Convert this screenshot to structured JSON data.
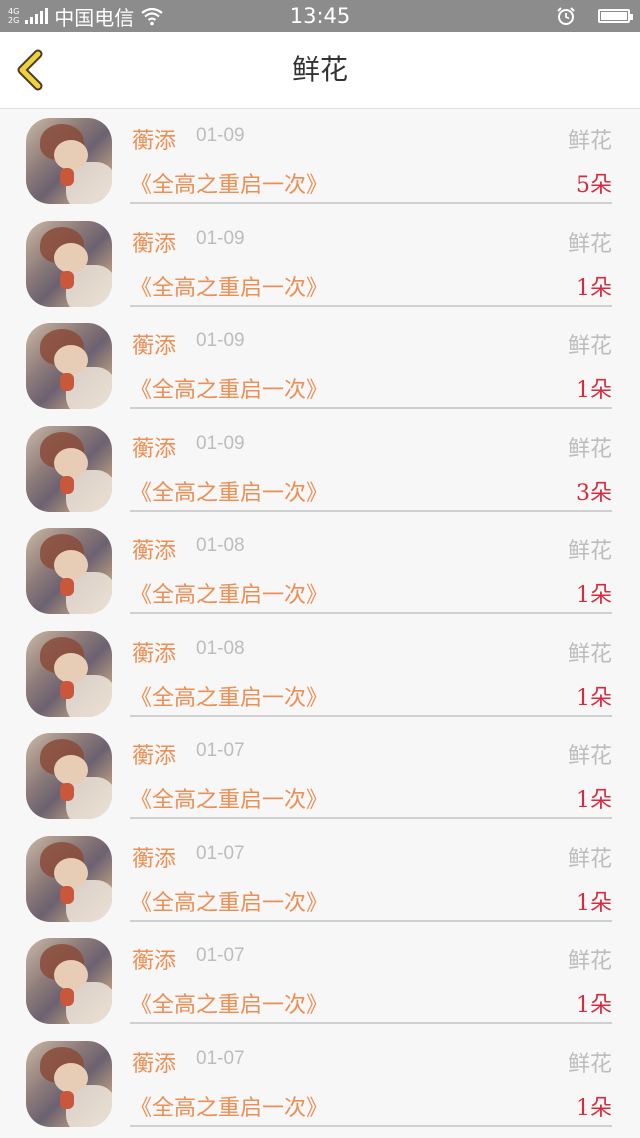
{
  "status_bar": {
    "net_top": "4G",
    "net_bottom": "2G",
    "carrier": "中国电信",
    "time": "13:45"
  },
  "header": {
    "title": "鲜花",
    "back_icon": "chevron-left-icon",
    "accent_color": "#f0d23c"
  },
  "colors": {
    "name": "#ec8f55",
    "count": "#d62a3f",
    "muted": "#bdbdbd"
  },
  "gifts": [
    {
      "name": "蘅添",
      "date": "01-09",
      "type": "鲜花",
      "book": "《全高之重启一次》",
      "count": "5朵"
    },
    {
      "name": "蘅添",
      "date": "01-09",
      "type": "鲜花",
      "book": "《全高之重启一次》",
      "count": "1朵"
    },
    {
      "name": "蘅添",
      "date": "01-09",
      "type": "鲜花",
      "book": "《全高之重启一次》",
      "count": "1朵"
    },
    {
      "name": "蘅添",
      "date": "01-09",
      "type": "鲜花",
      "book": "《全高之重启一次》",
      "count": "3朵"
    },
    {
      "name": "蘅添",
      "date": "01-08",
      "type": "鲜花",
      "book": "《全高之重启一次》",
      "count": "1朵"
    },
    {
      "name": "蘅添",
      "date": "01-08",
      "type": "鲜花",
      "book": "《全高之重启一次》",
      "count": "1朵"
    },
    {
      "name": "蘅添",
      "date": "01-07",
      "type": "鲜花",
      "book": "《全高之重启一次》",
      "count": "1朵"
    },
    {
      "name": "蘅添",
      "date": "01-07",
      "type": "鲜花",
      "book": "《全高之重启一次》",
      "count": "1朵"
    },
    {
      "name": "蘅添",
      "date": "01-07",
      "type": "鲜花",
      "book": "《全高之重启一次》",
      "count": "1朵"
    },
    {
      "name": "蘅添",
      "date": "01-07",
      "type": "鲜花",
      "book": "《全高之重启一次》",
      "count": "1朵"
    }
  ]
}
